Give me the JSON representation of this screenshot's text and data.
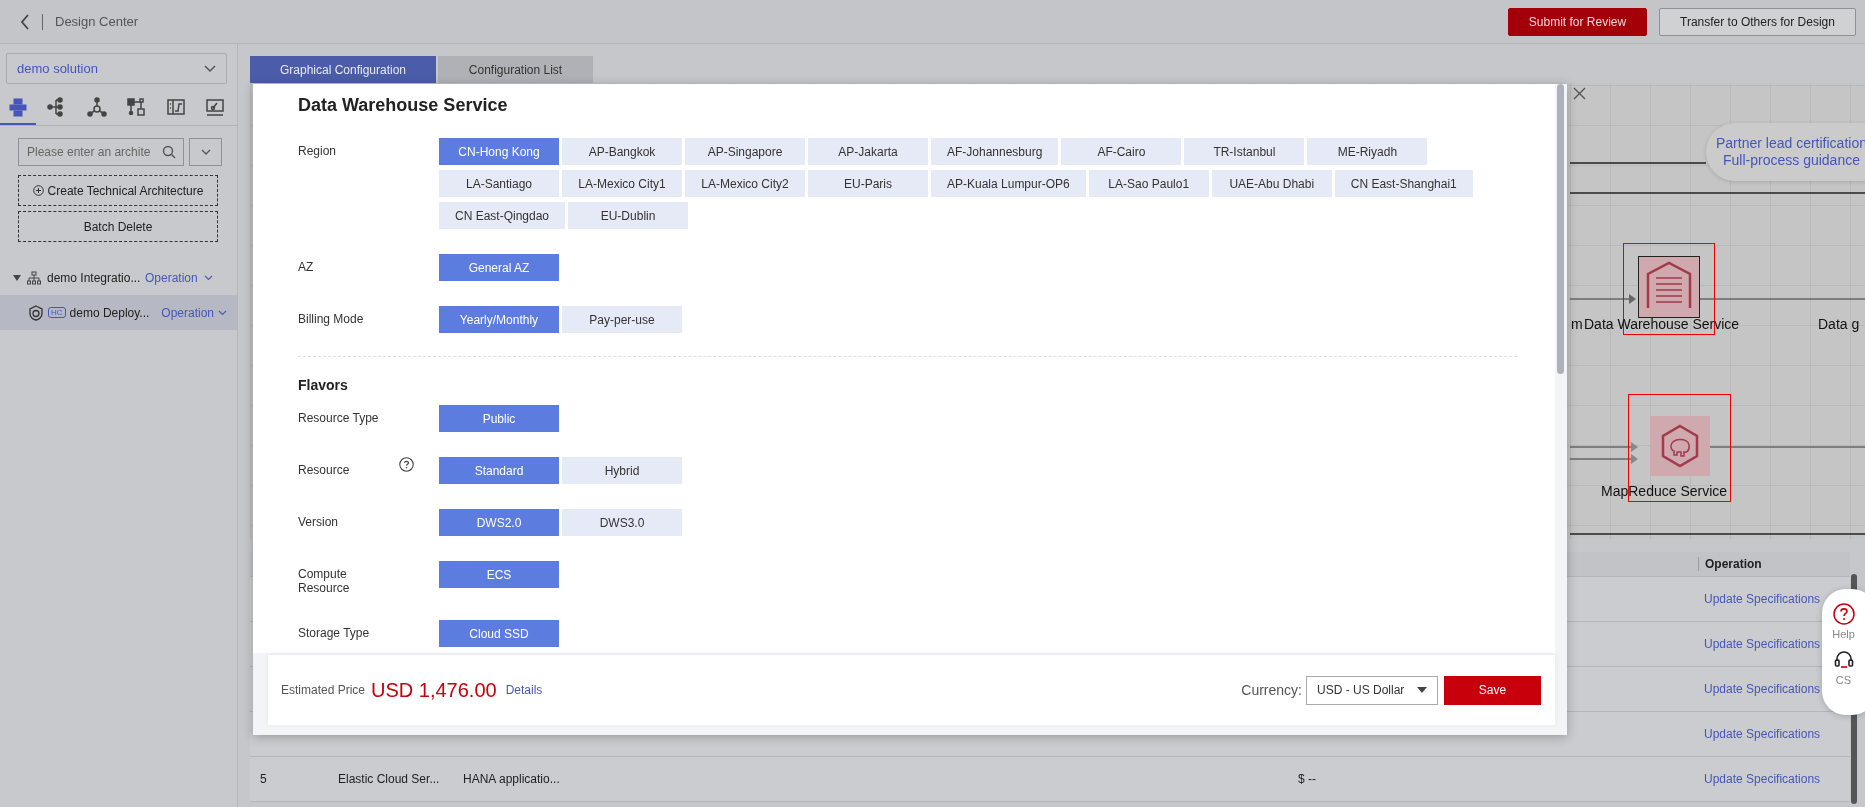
{
  "topbar": {
    "title": "Design Center",
    "buttons": [
      {
        "label": "Submit for Review",
        "kind": "primary"
      },
      {
        "label": "Transfer to Others for Design",
        "kind": "secondary"
      }
    ]
  },
  "sidebar": {
    "solution": "demo solution",
    "view_tabs": [
      {
        "selected": true
      },
      {
        "selected": false
      },
      {
        "selected": false
      },
      {
        "selected": false
      },
      {
        "selected": false
      },
      {
        "selected": false
      }
    ],
    "search": {
      "placeholder": "Please enter an archite"
    },
    "actions": [
      "Create Technical Architecture",
      "Batch Delete"
    ],
    "tree": [
      {
        "label": "demo Integratio...",
        "action": "Operation",
        "expanded": true,
        "selected": false,
        "children": [
          {
            "label": "demo Deploy...",
            "badge": "HC",
            "action": "Operation",
            "selected": true
          }
        ]
      }
    ]
  },
  "tabs": [
    {
      "label": "Graphical Configuration",
      "selected": true
    },
    {
      "label": "Configuration List",
      "selected": false
    }
  ],
  "canvas": {
    "bubble": [
      "Partner lead certification",
      "Full-process guidance"
    ],
    "nodes": [
      {
        "label": "Data Warehouse Service",
        "kind": "warehouse"
      },
      {
        "label": "MapReduce Service",
        "kind": "mapreduce"
      }
    ],
    "edge_labels": [
      "m",
      "Data g"
    ]
  },
  "table": {
    "operation_header": "Operation",
    "rows": [
      {
        "operation": "Update Specifications"
      },
      {
        "operation": "Update Specifications"
      },
      {
        "operation": "Update Specifications"
      },
      {
        "operation": "Update Specifications"
      },
      {
        "index": "5",
        "name": "Elastic Cloud Ser...",
        "description": "HANA applicatio...",
        "price": "$ --",
        "operation": "Update Specifications"
      }
    ]
  },
  "help_widget": [
    {
      "label": "Help",
      "kind": "help"
    },
    {
      "label": "CS",
      "kind": "support"
    }
  ],
  "modal": {
    "title": "Data Warehouse Service",
    "groups": [
      {
        "fields": [
          {
            "label": "Region",
            "options": [
              {
                "label": "CN-Hong Kong",
                "selected": true
              },
              {
                "label": "AP-Bangkok",
                "selected": false
              },
              {
                "label": "AP-Singapore",
                "selected": false
              },
              {
                "label": "AP-Jakarta",
                "selected": false
              },
              {
                "label": "AF-Johannesburg",
                "selected": false
              },
              {
                "label": "AF-Cairo",
                "selected": false
              },
              {
                "label": "TR-Istanbul",
                "selected": false
              },
              {
                "label": "ME-Riyadh",
                "selected": false
              },
              {
                "label": "LA-Santiago",
                "selected": false
              },
              {
                "label": "LA-Mexico City1",
                "selected": false
              },
              {
                "label": "LA-Mexico City2",
                "selected": false
              },
              {
                "label": "EU-Paris",
                "selected": false
              },
              {
                "label": "AP-Kuala Lumpur-OP6",
                "selected": false
              },
              {
                "label": "LA-Sao Paulo1",
                "selected": false
              },
              {
                "label": "UAE-Abu Dhabi",
                "selected": false
              },
              {
                "label": "CN East-Shanghai1",
                "selected": false
              },
              {
                "label": "CN East-Qingdao",
                "selected": false
              },
              {
                "label": "EU-Dublin",
                "selected": false
              }
            ]
          },
          {
            "label": "AZ",
            "options": [
              {
                "label": "General AZ",
                "selected": true
              }
            ]
          },
          {
            "label": "Billing Mode",
            "options": [
              {
                "label": "Yearly/Monthly",
                "selected": true
              },
              {
                "label": "Pay-per-use",
                "selected": false
              }
            ]
          }
        ]
      },
      {
        "heading": "Flavors",
        "fields": [
          {
            "label": "Resource Type",
            "options": [
              {
                "label": "Public",
                "selected": true
              }
            ]
          },
          {
            "label": "Resource",
            "help": true,
            "options": [
              {
                "label": "Standard",
                "selected": true
              },
              {
                "label": "Hybrid",
                "selected": false
              }
            ]
          },
          {
            "label": "Version",
            "options": [
              {
                "label": "DWS2.0",
                "selected": true
              },
              {
                "label": "DWS3.0",
                "selected": false
              }
            ]
          },
          {
            "label": "Compute Resource",
            "options": [
              {
                "label": "ECS",
                "selected": true
              }
            ]
          },
          {
            "label": "Storage Type",
            "options": [
              {
                "label": "Cloud SSD",
                "selected": true
              }
            ]
          }
        ]
      }
    ],
    "footer": {
      "price_label": "Estimated Price",
      "price": "USD 1,476.00",
      "details": "Details",
      "currency_label": "Currency:",
      "currency": "USD - US Dollar",
      "save": "Save"
    }
  }
}
